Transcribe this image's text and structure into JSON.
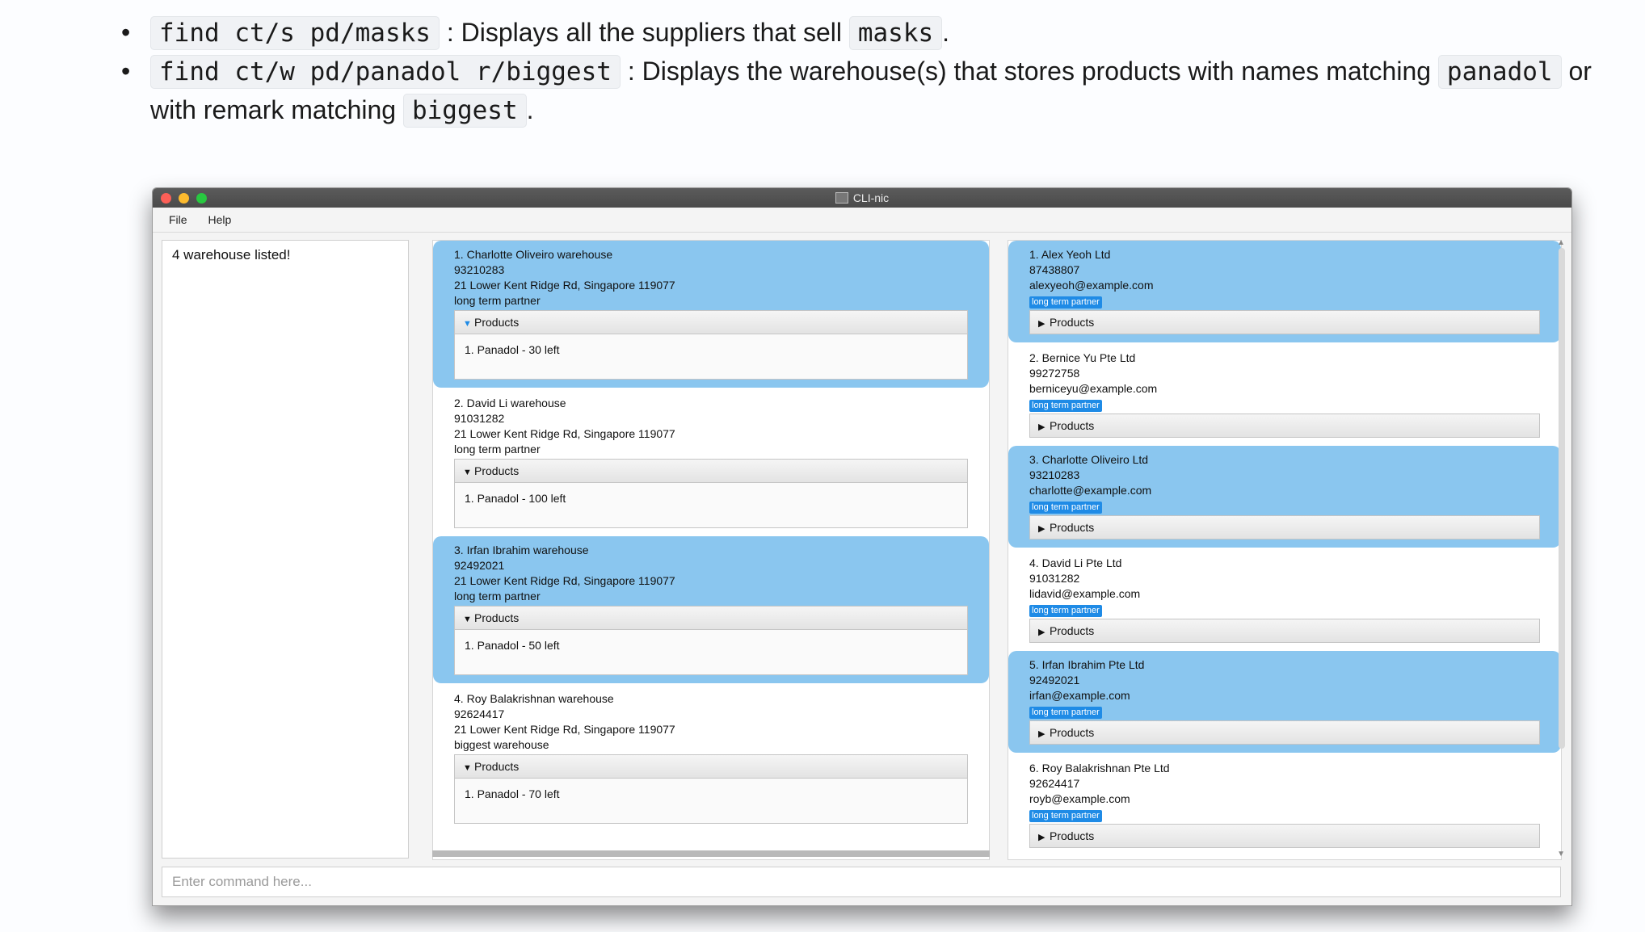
{
  "bullets": [
    {
      "code1": "find ct/s pd/masks",
      "text1": ": Displays all the suppliers that sell",
      "code2": "masks",
      "text2": "."
    },
    {
      "code1": "find ct/w pd/panadol r/biggest",
      "text1": ": Displays the warehouse(s) that stores products with names matching",
      "code2": "panadol",
      "text2": "or",
      "text3": "with remark matching",
      "code3": "biggest",
      "text4": "."
    }
  ],
  "window": {
    "title": "CLI-nic",
    "menu": [
      "File",
      "Help"
    ],
    "result": "4 warehouse listed!",
    "command_placeholder": "Enter command here...",
    "products_label": "Products",
    "tag_label": "long term partner"
  },
  "warehouses": [
    {
      "index": "1.",
      "name": "Charlotte Oliveiro warehouse",
      "phone": "93210283",
      "address": "21 Lower Kent Ridge Rd, Singapore 119077",
      "remark": "long term partner",
      "product": "1. Panadol - 30 left",
      "selected": true
    },
    {
      "index": "2.",
      "name": "David Li warehouse",
      "phone": "91031282",
      "address": "21 Lower Kent Ridge Rd, Singapore 119077",
      "remark": "long term partner",
      "product": "1. Panadol - 100 left",
      "selected": false
    },
    {
      "index": "3.",
      "name": "Irfan Ibrahim warehouse",
      "phone": "92492021",
      "address": "21 Lower Kent Ridge Rd, Singapore 119077",
      "remark": "long term partner",
      "product": "1. Panadol - 50 left",
      "selected": true
    },
    {
      "index": "4.",
      "name": "Roy Balakrishnan warehouse",
      "phone": "92624417",
      "address": "21 Lower Kent Ridge Rd, Singapore 119077",
      "remark": "biggest warehouse",
      "product": "1. Panadol - 70 left",
      "selected": false
    }
  ],
  "suppliers": [
    {
      "index": "1.",
      "name": "Alex Yeoh Ltd",
      "phone": "87438807",
      "email": "alexyeoh@example.com",
      "selected": true
    },
    {
      "index": "2.",
      "name": "Bernice Yu Pte Ltd",
      "phone": "99272758",
      "email": "berniceyu@example.com",
      "selected": false
    },
    {
      "index": "3.",
      "name": "Charlotte Oliveiro Ltd",
      "phone": "93210283",
      "email": "charlotte@example.com",
      "selected": true
    },
    {
      "index": "4.",
      "name": "David Li Pte Ltd",
      "phone": "91031282",
      "email": "lidavid@example.com",
      "selected": false
    },
    {
      "index": "5.",
      "name": "Irfan Ibrahim Pte Ltd",
      "phone": "92492021",
      "email": "irfan@example.com",
      "selected": true
    },
    {
      "index": "6.",
      "name": "Roy Balakrishnan Pte Ltd",
      "phone": "92624417",
      "email": "royb@example.com",
      "selected": false
    }
  ]
}
